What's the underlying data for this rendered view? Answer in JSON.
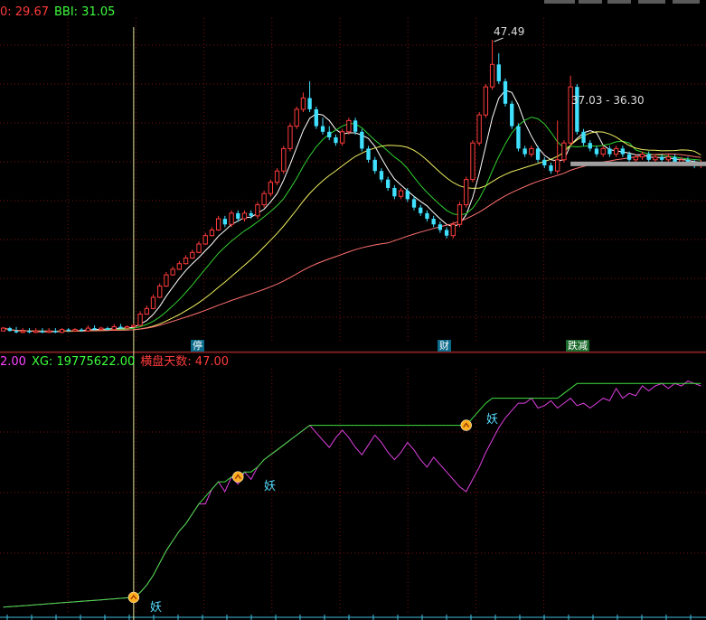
{
  "header_main": {
    "item1": "0: 29.67",
    "item2": "BBI: 31.05"
  },
  "header_sub": {
    "item1": "2.00",
    "item2": "XG: 19775622.00",
    "item3": "横盘天数: 47.00"
  },
  "tags": [
    {
      "label": "停"
    },
    {
      "label": "财"
    },
    {
      "label": "跌减"
    }
  ],
  "annotations": {
    "high_label": "47.49",
    "range_label": "37.03 - 36.30"
  },
  "yao_markers": [
    {
      "label": "妖"
    },
    {
      "label": "妖"
    },
    {
      "label": "妖"
    }
  ],
  "colors": {
    "background": "#000000",
    "grid": "#7a1010",
    "up": "#ff3b3b",
    "down": "#40e0ff",
    "ma_white": "#ffffff",
    "ma_yellow": "#f0f060",
    "ma_green": "#30d030",
    "ma_pink": "#ff7070",
    "xg_line": "#40e040",
    "indicator_line": "#e040e0",
    "marker": "#ffb020"
  },
  "chart_data": [
    {
      "type": "candlestick",
      "n_bars": 108,
      "ylim": [
        19.5,
        49.5
      ],
      "grid": true,
      "ohlc": [
        [
          20.49,
          20.75,
          20.63,
          20.86
        ],
        [
          20.75,
          20.49,
          20.44,
          20.86
        ],
        [
          20.49,
          20.36,
          20.28,
          20.86
        ],
        [
          20.36,
          20.49,
          20.28,
          20.75
        ],
        [
          20.49,
          20.36,
          20.28,
          20.75
        ],
        [
          20.36,
          20.49,
          20.28,
          20.75
        ],
        [
          20.49,
          20.36,
          20.28,
          20.75
        ],
        [
          20.36,
          20.49,
          20.28,
          20.75
        ],
        [
          20.49,
          20.36,
          20.28,
          20.75
        ],
        [
          20.36,
          20.62,
          20.28,
          20.75
        ],
        [
          20.62,
          20.49,
          20.41,
          20.75
        ],
        [
          20.49,
          20.62,
          20.41,
          20.75
        ],
        [
          20.62,
          20.49,
          20.41,
          20.75
        ],
        [
          20.49,
          20.75,
          20.41,
          21.01
        ],
        [
          20.75,
          20.62,
          20.54,
          21.01
        ],
        [
          20.62,
          20.75,
          20.54,
          20.88
        ],
        [
          20.75,
          20.62,
          20.54,
          20.88
        ],
        [
          20.62,
          20.88,
          20.54,
          21.14
        ],
        [
          20.88,
          20.75,
          20.67,
          21.14
        ],
        [
          20.75,
          20.88,
          20.67,
          21.01
        ],
        [
          20.88,
          21.01,
          20.8,
          21.14
        ],
        [
          21.01,
          22.05,
          20.93,
          22.32
        ],
        [
          22.05,
          22.57,
          21.97,
          22.84
        ],
        [
          22.57,
          23.61,
          22.49,
          23.87
        ],
        [
          23.61,
          24.65,
          23.53,
          24.91
        ],
        [
          24.65,
          25.69,
          24.57,
          25.95
        ],
        [
          25.69,
          26.21,
          25.61,
          26.47
        ],
        [
          26.21,
          26.73,
          26.13,
          26.99
        ],
        [
          26.73,
          27.25,
          26.65,
          27.51
        ],
        [
          27.25,
          27.77,
          27.17,
          28.03
        ],
        [
          27.77,
          28.55,
          27.69,
          28.81
        ],
        [
          28.55,
          29.33,
          28.47,
          29.59
        ],
        [
          29.33,
          29.85,
          29.25,
          30.11
        ],
        [
          29.85,
          30.89,
          29.77,
          31.16
        ],
        [
          30.89,
          30.37,
          30.11,
          31.16
        ],
        [
          30.37,
          31.41,
          30.11,
          31.67
        ],
        [
          31.41,
          30.89,
          30.63,
          31.67
        ],
        [
          30.89,
          31.41,
          30.63,
          31.67
        ],
        [
          31.41,
          31.16,
          30.89,
          31.67
        ],
        [
          31.16,
          32.19,
          30.89,
          32.45
        ],
        [
          32.19,
          33.23,
          31.93,
          33.49
        ],
        [
          33.23,
          34.27,
          32.97,
          34.53
        ],
        [
          34.27,
          35.32,
          34.01,
          35.58
        ],
        [
          35.32,
          37.4,
          35.06,
          37.66
        ],
        [
          37.4,
          39.48,
          37.14,
          39.74
        ],
        [
          39.48,
          41.04,
          39.22,
          41.3
        ],
        [
          41.04,
          42.08,
          40.78,
          42.6
        ],
        [
          42.08,
          41.04,
          40.78,
          43.64
        ],
        [
          41.04,
          39.48,
          39.22,
          41.3
        ],
        [
          39.48,
          38.96,
          38.7,
          40.26
        ],
        [
          38.96,
          38.44,
          38.18,
          39.48
        ],
        [
          38.44,
          37.92,
          37.66,
          38.7
        ],
        [
          37.92,
          38.96,
          37.66,
          39.22
        ],
        [
          38.96,
          40.0,
          38.7,
          40.26
        ],
        [
          40.0,
          38.96,
          38.7,
          40.26
        ],
        [
          38.96,
          37.4,
          37.14,
          39.22
        ],
        [
          37.4,
          36.36,
          36.1,
          37.66
        ],
        [
          36.36,
          35.32,
          35.06,
          36.62
        ],
        [
          35.32,
          34.53,
          34.27,
          35.58
        ],
        [
          34.53,
          33.75,
          33.49,
          34.79
        ],
        [
          33.75,
          32.97,
          32.71,
          34.01
        ],
        [
          32.97,
          33.49,
          32.71,
          33.75
        ],
        [
          33.49,
          32.71,
          32.45,
          33.75
        ],
        [
          32.71,
          31.93,
          31.67,
          32.97
        ],
        [
          31.93,
          31.41,
          31.16,
          32.19
        ],
        [
          31.41,
          30.89,
          30.63,
          31.67
        ],
        [
          30.89,
          30.37,
          30.11,
          31.16
        ],
        [
          30.37,
          29.85,
          29.59,
          30.63
        ],
        [
          29.85,
          29.33,
          29.07,
          30.11
        ],
        [
          29.33,
          30.37,
          29.07,
          30.63
        ],
        [
          30.37,
          32.19,
          30.11,
          32.45
        ],
        [
          32.19,
          34.53,
          31.93,
          34.79
        ],
        [
          34.53,
          37.92,
          34.27,
          38.18
        ],
        [
          37.92,
          40.52,
          37.66,
          40.78
        ],
        [
          40.52,
          43.12,
          40.26,
          43.38
        ],
        [
          43.12,
          45.2,
          42.86,
          47.49
        ],
        [
          45.2,
          43.64,
          43.38,
          46.24
        ],
        [
          43.64,
          41.56,
          41.3,
          43.9
        ],
        [
          41.56,
          39.48,
          39.22,
          41.82
        ],
        [
          39.48,
          37.4,
          37.14,
          39.74
        ],
        [
          37.4,
          36.88,
          36.62,
          37.66
        ],
        [
          36.88,
          37.4,
          36.62,
          37.66
        ],
        [
          37.4,
          36.36,
          36.1,
          37.66
        ],
        [
          36.36,
          35.84,
          35.58,
          36.62
        ],
        [
          35.84,
          35.32,
          35.06,
          36.1
        ],
        [
          35.32,
          36.36,
          35.06,
          40.0
        ],
        [
          36.36,
          37.92,
          36.1,
          38.18
        ],
        [
          37.92,
          43.12,
          37.66,
          44.16
        ],
        [
          43.12,
          38.96,
          38.7,
          43.38
        ],
        [
          38.96,
          37.92,
          37.66,
          39.22
        ],
        [
          37.92,
          37.4,
          37.14,
          38.18
        ],
        [
          37.4,
          36.88,
          36.62,
          37.66
        ],
        [
          36.88,
          37.4,
          36.62,
          37.66
        ],
        [
          37.4,
          36.88,
          36.62,
          37.66
        ],
        [
          36.88,
          37.4,
          36.62,
          37.66
        ],
        [
          37.4,
          36.88,
          36.62,
          37.66
        ],
        [
          36.88,
          36.36,
          36.1,
          37.14
        ],
        [
          36.36,
          36.62,
          36.1,
          36.88
        ],
        [
          36.62,
          36.88,
          36.36,
          37.14
        ],
        [
          36.88,
          36.36,
          36.1,
          37.14
        ],
        [
          36.36,
          36.62,
          36.1,
          36.88
        ],
        [
          36.62,
          36.36,
          36.1,
          36.88
        ],
        [
          36.36,
          36.62,
          36.1,
          36.88
        ],
        [
          36.62,
          36.1,
          35.84,
          36.88
        ],
        [
          36.1,
          36.36,
          35.84,
          36.62
        ],
        [
          36.36,
          36.1,
          35.84,
          36.62
        ],
        [
          36.1,
          35.84,
          35.58,
          36.36
        ],
        [
          35.84,
          36.1,
          35.58,
          36.36
        ]
      ],
      "ma_lines": [
        {
          "color": "#ffffff",
          "period": 5
        },
        {
          "color": "#30d030",
          "period": 10
        },
        {
          "color": "#f0f060",
          "period": 20
        },
        {
          "color": "#ff7070",
          "period": 60
        }
      ],
      "high_marker": {
        "bar": 75,
        "value": 47.49
      },
      "range_marker": {
        "bar": 87,
        "values": [
          37.03,
          36.3
        ]
      }
    },
    {
      "type": "line",
      "n_bars": 108,
      "ylim": [
        0,
        100
      ],
      "series": [
        {
          "color": "#40e040",
          "values": [
            3.0,
            3.2,
            3.4,
            3.6,
            3.8,
            4.0,
            4.2,
            4.4,
            4.6,
            4.8,
            5.0,
            5.2,
            5.4,
            5.6,
            5.8,
            6.0,
            6.2,
            6.4,
            6.6,
            6.8,
            7.0,
            9.0,
            12.0,
            16.0,
            21.0,
            26.0,
            30.0,
            34.0,
            37.0,
            41.0,
            45.0,
            48.0,
            51.0,
            54.0,
            54.0,
            56.0,
            56.0,
            58.0,
            58.0,
            60.0,
            63.0,
            65.0,
            67.0,
            69.0,
            71.0,
            73.0,
            75.0,
            77.0,
            77.0,
            77.0,
            77.0,
            77.0,
            77.0,
            77.0,
            77.0,
            77.0,
            77.0,
            77.0,
            77.0,
            77.0,
            77.0,
            77.0,
            77.0,
            77.0,
            77.0,
            77.0,
            77.0,
            77.0,
            77.0,
            77.0,
            77.0,
            77.0,
            80.0,
            83.0,
            86.0,
            88.0,
            88.0,
            88.0,
            88.0,
            88.0,
            88.0,
            88.0,
            88.0,
            88.0,
            88.0,
            88.0,
            90.0,
            92.0,
            94.0,
            94.0,
            94.0,
            94.0,
            94.0,
            94.0,
            94.0,
            94.0,
            94.0,
            94.0,
            94.0,
            94.0,
            94.0,
            94.0,
            94.0,
            94.0,
            94.0,
            94.0,
            94.0,
            94.0
          ]
        },
        {
          "color": "#e040e0",
          "values": [
            3.0,
            3.2,
            3.4,
            3.6,
            3.8,
            4.0,
            4.2,
            4.4,
            4.6,
            4.8,
            5.0,
            5.2,
            5.4,
            5.6,
            5.8,
            6.0,
            6.2,
            6.4,
            6.6,
            6.8,
            7.0,
            9.0,
            12.0,
            16.0,
            21.0,
            26.0,
            30.0,
            34.0,
            37.0,
            41.0,
            45.0,
            45.0,
            51.0,
            54.0,
            50.0,
            56.0,
            53.0,
            58.0,
            55.0,
            60.0,
            63.0,
            65.0,
            67.0,
            69.0,
            71.0,
            73.0,
            75.0,
            77.0,
            74.0,
            71.0,
            68.0,
            72.0,
            75.0,
            72.0,
            68.0,
            65.0,
            69.0,
            73.0,
            70.0,
            66.0,
            63.0,
            66.0,
            70.0,
            67.0,
            63.0,
            60.0,
            64.0,
            61.0,
            58.0,
            55.0,
            52.0,
            50.0,
            55.0,
            60.0,
            66.0,
            71.0,
            76.0,
            80.0,
            83.0,
            86.0,
            86.0,
            88.0,
            84.0,
            85.0,
            87.0,
            84.0,
            86.0,
            88.0,
            85.0,
            86.0,
            84.0,
            86.0,
            88.0,
            87.0,
            92.0,
            88.0,
            90.0,
            89.0,
            93.0,
            91.0,
            93.0,
            94.0,
            92.0,
            94.0,
            93.0,
            95.0,
            94.0,
            93.0
          ]
        }
      ],
      "signal_bars": [
        20,
        36,
        71
      ]
    }
  ]
}
